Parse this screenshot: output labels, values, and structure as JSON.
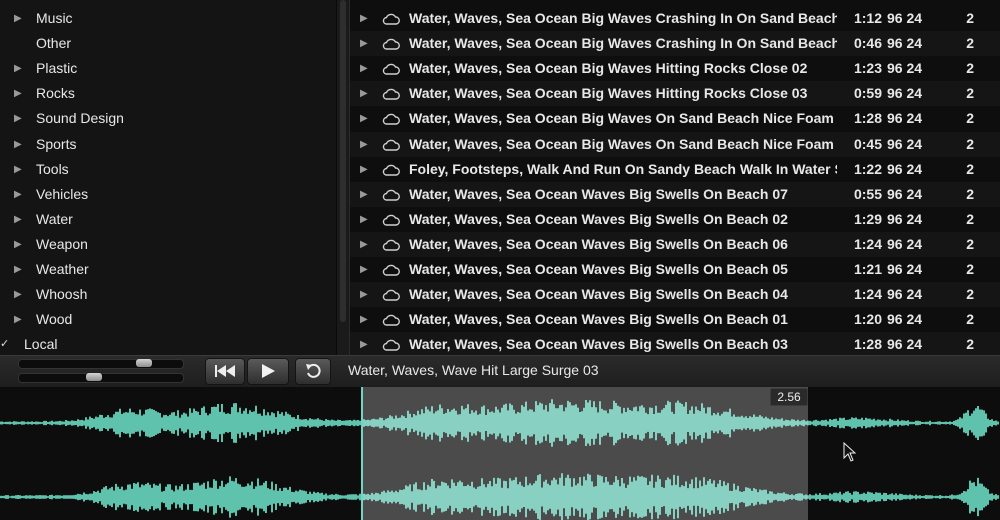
{
  "categories": [
    {
      "label": "Music",
      "expandable": true
    },
    {
      "label": "Other",
      "expandable": false
    },
    {
      "label": "Plastic",
      "expandable": true
    },
    {
      "label": "Rocks",
      "expandable": true
    },
    {
      "label": "Sound Design",
      "expandable": true
    },
    {
      "label": "Sports",
      "expandable": true
    },
    {
      "label": "Tools",
      "expandable": true
    },
    {
      "label": "Vehicles",
      "expandable": true
    },
    {
      "label": "Water",
      "expandable": true
    },
    {
      "label": "Weapon",
      "expandable": true
    },
    {
      "label": "Weather",
      "expandable": true
    },
    {
      "label": "Whoosh",
      "expandable": true
    },
    {
      "label": "Wood",
      "expandable": true
    }
  ],
  "local": {
    "label": "Local",
    "checked": true,
    "check_glyph": "✓"
  },
  "sounds": [
    {
      "name": "Water, Waves, Sea Ocean Big Waves Crashing In On Sand Beach S...",
      "duration": "1:12",
      "format": "96 24",
      "channels": "2"
    },
    {
      "name": "Water, Waves, Sea Ocean Big Waves Crashing In On Sand Beach S...",
      "duration": "0:46",
      "format": "96 24",
      "channels": "2"
    },
    {
      "name": "Water, Waves, Sea Ocean Big Waves Hitting Rocks Close 02",
      "duration": "1:23",
      "format": "96 24",
      "channels": "2"
    },
    {
      "name": "Water, Waves, Sea Ocean Big Waves Hitting Rocks Close 03",
      "duration": "0:59",
      "format": "96 24",
      "channels": "2"
    },
    {
      "name": "Water, Waves, Sea Ocean Big Waves On Sand Beach Nice Foam D...",
      "duration": "1:28",
      "format": "96 24",
      "channels": "2"
    },
    {
      "name": "Water, Waves, Sea Ocean Big Waves On Sand Beach Nice Foam D...",
      "duration": "0:45",
      "format": "96 24",
      "channels": "2"
    },
    {
      "name": "Foley, Footsteps, Walk And Run On Sandy Beach Walk In Water S...",
      "duration": "1:22",
      "format": "96 24",
      "channels": "2"
    },
    {
      "name": "Water, Waves, Sea Ocean Waves Big Swells On Beach 07",
      "duration": "0:55",
      "format": "96 24",
      "channels": "2"
    },
    {
      "name": "Water, Waves, Sea Ocean Waves Big Swells On Beach 02",
      "duration": "1:29",
      "format": "96 24",
      "channels": "2"
    },
    {
      "name": "Water, Waves, Sea Ocean Waves Big Swells On Beach 06",
      "duration": "1:24",
      "format": "96 24",
      "channels": "2"
    },
    {
      "name": "Water, Waves, Sea Ocean Waves Big Swells On Beach 05",
      "duration": "1:21",
      "format": "96 24",
      "channels": "2"
    },
    {
      "name": "Water, Waves, Sea Ocean Waves Big Swells On Beach 04",
      "duration": "1:24",
      "format": "96 24",
      "channels": "2"
    },
    {
      "name": "Water, Waves, Sea Ocean Waves Big Swells On Beach 01",
      "duration": "1:20",
      "format": "96 24",
      "channels": "2"
    },
    {
      "name": "Water, Waves, Sea Ocean Waves Big Swells On Beach 03",
      "duration": "1:28",
      "format": "96 24",
      "channels": "2"
    }
  ],
  "player": {
    "now_playing": "Water, Waves, Wave Hit Large Surge 03",
    "time_marker": "2.56",
    "volume_level": 0.79,
    "pitch_level": 0.45,
    "buttons": {
      "rewind_icon": "rewind-icon",
      "play_icon": "play-icon",
      "loop_icon": "loop-icon"
    }
  },
  "colors": {
    "waveform": "#5fc2ad",
    "selection": "#8e8e8e",
    "background": "#111111"
  }
}
